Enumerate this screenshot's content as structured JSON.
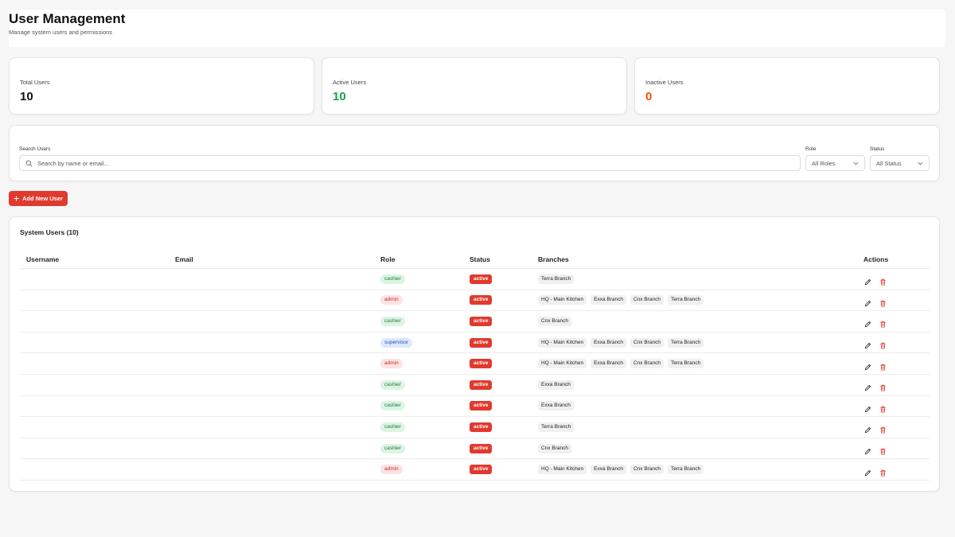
{
  "header": {
    "title": "User Management",
    "subtitle": "Manage system users and permissions"
  },
  "stats": [
    {
      "label": "Total Users",
      "value": "10",
      "color": "#111111"
    },
    {
      "label": "Active Users",
      "value": "10",
      "color": "#16a34a"
    },
    {
      "label": "Inactive Users",
      "value": "0",
      "color": "#ea580c"
    }
  ],
  "filters": {
    "search_label": "Search Users",
    "search_placeholder": "Search by name or email...",
    "role_label": "Role",
    "role_value": "All Roles",
    "status_label": "Status",
    "status_value": "All Status"
  },
  "add_button": {
    "label": "Add New User"
  },
  "table": {
    "title": "System Users (10)",
    "columns": [
      "Username",
      "Email",
      "Role",
      "Status",
      "Branches",
      "Actions"
    ],
    "rows": [
      {
        "username": "",
        "email": "",
        "role": "cashier",
        "status": "active",
        "branches": [
          "Terra Branch"
        ]
      },
      {
        "username": "",
        "email": "",
        "role": "admin",
        "status": "active",
        "branches": [
          "HQ - Main Kitchen",
          "Exxa Branch",
          "Cnx Branch",
          "Terra Branch"
        ]
      },
      {
        "username": "",
        "email": "",
        "role": "cashier",
        "status": "active",
        "branches": [
          "Cnx Branch"
        ]
      },
      {
        "username": "",
        "email": "",
        "role": "supervisor",
        "status": "active",
        "branches": [
          "HQ - Main Kitchen",
          "Exxa Branch",
          "Cnx Branch",
          "Terra Branch"
        ]
      },
      {
        "username": "",
        "email": "",
        "role": "admin",
        "status": "active",
        "branches": [
          "HQ - Main Kitchen",
          "Exxa Branch",
          "Cnx Branch",
          "Terra Branch"
        ]
      },
      {
        "username": "",
        "email": "",
        "role": "cashier",
        "status": "active",
        "branches": [
          "Exxa Branch"
        ]
      },
      {
        "username": "",
        "email": "",
        "role": "cashier",
        "status": "active",
        "branches": [
          "Exxa Branch"
        ]
      },
      {
        "username": "",
        "email": "",
        "role": "cashier",
        "status": "active",
        "branches": [
          "Terra Branch"
        ]
      },
      {
        "username": "",
        "email": "",
        "role": "cashier",
        "status": "active",
        "branches": [
          "Cnx Branch"
        ]
      },
      {
        "username": "",
        "email": "",
        "role": "admin",
        "status": "active",
        "branches": [
          "HQ - Main Kitchen",
          "Exxa Branch",
          "Cnx Branch",
          "Terra Branch"
        ]
      }
    ]
  },
  "icons": {
    "search": "search-icon",
    "chevron": "chevron-down-icon",
    "plus": "plus-icon",
    "edit": "pencil-icon",
    "delete": "trash-icon"
  },
  "colors": {
    "accent": "#e03a2e",
    "active_green": "#16a34a",
    "inactive_orange": "#ea580c"
  }
}
